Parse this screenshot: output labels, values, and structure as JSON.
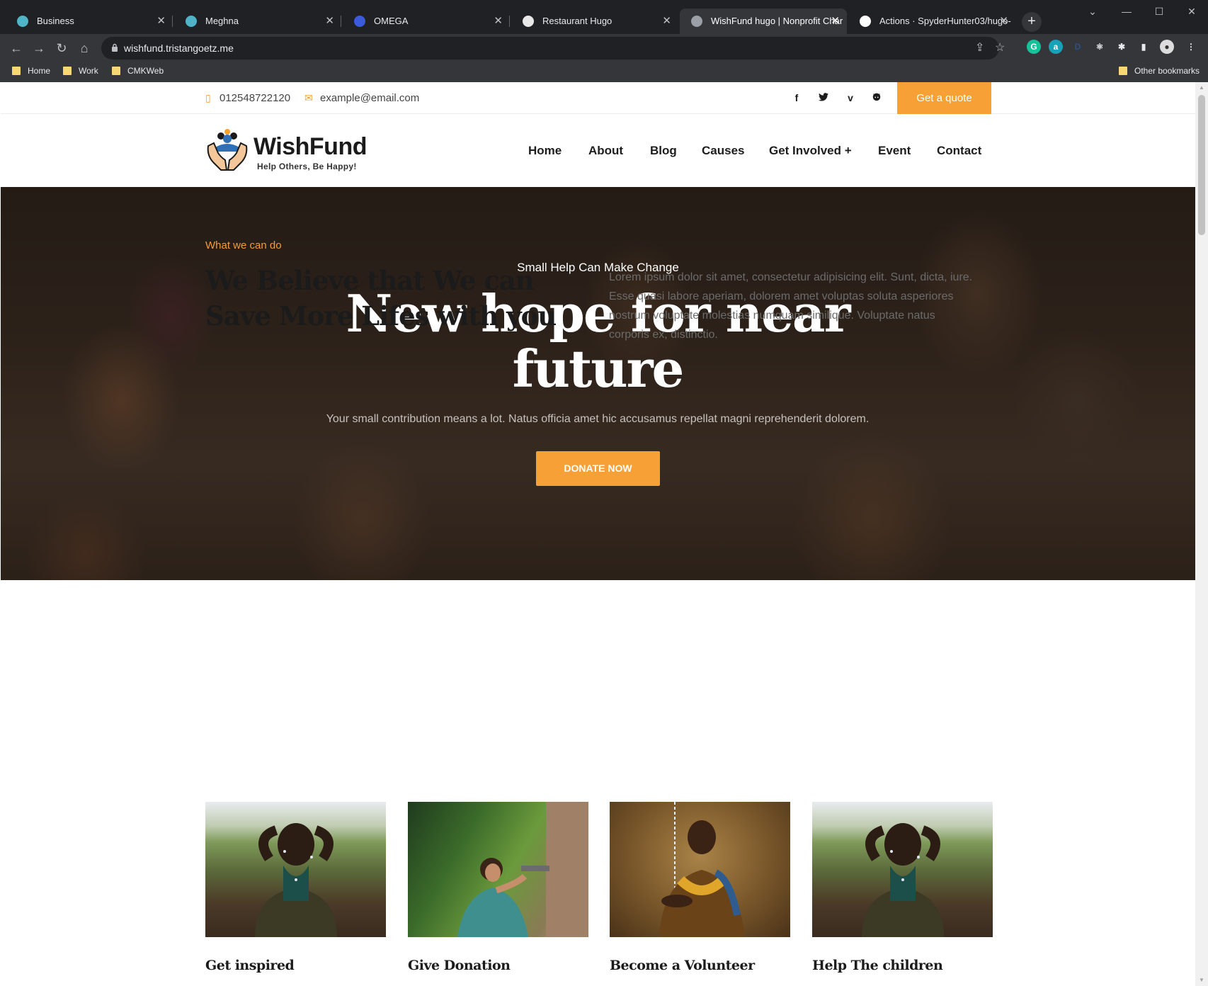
{
  "browser": {
    "tabs": [
      {
        "title": "Business",
        "active": false,
        "favicon_color": "#4fb4c8"
      },
      {
        "title": "Meghna",
        "active": false,
        "favicon_color": "#4fb4c8"
      },
      {
        "title": "OMEGA",
        "active": false,
        "favicon_color": "#3b5bdb"
      },
      {
        "title": "Restaurant Hugo",
        "active": false,
        "favicon_color": "#e8e8e8"
      },
      {
        "title": "WishFund hugo | Nonprofit Char",
        "active": true,
        "favicon_color": "#9aa0a6"
      },
      {
        "title": "Actions · SpyderHunter03/hugo-",
        "active": false,
        "favicon_color": "#ffffff"
      }
    ],
    "url": "wishfund.tristangoetz.me",
    "bookmarks": [
      "Home",
      "Work",
      "CMKWeb"
    ],
    "other_bookmarks": "Other bookmarks"
  },
  "topbar": {
    "phone": "012548722120",
    "email": "example@email.com",
    "social": [
      "facebook-icon",
      "twitter-icon",
      "vimeo-icon",
      "github-icon"
    ],
    "quote_label": "Get a quote"
  },
  "header": {
    "logo_name": "WishFund",
    "logo_tagline": "Help Others, Be Happy!",
    "nav": [
      "Home",
      "About",
      "Blog",
      "Causes",
      "Get Involved +",
      "Event",
      "Contact"
    ]
  },
  "hero": {
    "subtitle": "Small Help Can Make Change",
    "title": "New hope for near future",
    "description": "Your small contribution means a lot. Natus officia amet hic accusamus repellat magni reprehenderit dolorem.",
    "button_label": "DONATE NOW"
  },
  "about": {
    "eyebrow": "What we can do",
    "title": "We Believe that We can Save More Lifes with you",
    "description": "Lorem ipsum dolor sit amet, consectetur adipisicing elit. Sunt, dicta, iure. Esse quasi labore aperiam, dolorem amet voluptas soluta asperiores nostrum voluptate molestias numquam similique. Voluptate natus corporis ex, distinctio."
  },
  "cards": [
    {
      "title": "Get inspired"
    },
    {
      "title": "Give Donation"
    },
    {
      "title": "Become a Volunteer"
    },
    {
      "title": "Help The children"
    }
  ],
  "colors": {
    "accent": "#f7a035",
    "heading": "#1b1b1b",
    "chrome_dark": "#202124",
    "chrome_toolbar": "#35363a"
  }
}
